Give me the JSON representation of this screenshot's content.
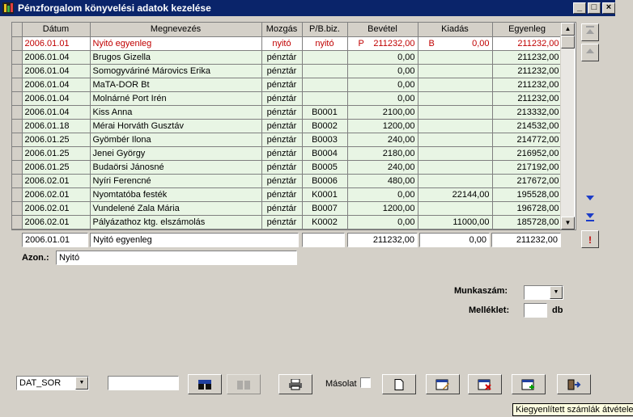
{
  "window": {
    "title": "Pénzforgalom könyvelési adatok kezelése",
    "minimize": "_",
    "restore": "□",
    "close": "×"
  },
  "table": {
    "columns": [
      "Dátum",
      "Megnevezés",
      "Mozgás",
      "P/B.biz.",
      "Bevétel",
      "Kiadás",
      "Egyenleg"
    ],
    "rows": [
      {
        "date": "2006.01.01",
        "name": "Nyitó egyenleg",
        "move": "nyitó",
        "doc": "nyitó",
        "inc_tag": "P",
        "income": "211232,00",
        "exp_tag": "B",
        "expense": "0,00",
        "balance": "211232,00"
      },
      {
        "date": "2006.01.04",
        "name": "Brugos Gizella",
        "move": "pénztár",
        "doc": "",
        "inc_tag": "",
        "income": "0,00",
        "exp_tag": "",
        "expense": "",
        "balance": "211232,00"
      },
      {
        "date": "2006.01.04",
        "name": "Somogyváriné Márovics Erika",
        "move": "pénztár",
        "doc": "",
        "inc_tag": "",
        "income": "0,00",
        "exp_tag": "",
        "expense": "",
        "balance": "211232,00"
      },
      {
        "date": "2006.01.04",
        "name": "MaTA-DOR Bt",
        "move": "pénztár",
        "doc": "",
        "inc_tag": "",
        "income": "0,00",
        "exp_tag": "",
        "expense": "",
        "balance": "211232,00"
      },
      {
        "date": "2006.01.04",
        "name": "Molnárné Port Irén",
        "move": "pénztár",
        "doc": "",
        "inc_tag": "",
        "income": "0,00",
        "exp_tag": "",
        "expense": "",
        "balance": "211232,00"
      },
      {
        "date": "2006.01.04",
        "name": "Kiss Anna",
        "move": "pénztár",
        "doc": "B0001",
        "inc_tag": "",
        "income": "2100,00",
        "exp_tag": "",
        "expense": "",
        "balance": "213332,00"
      },
      {
        "date": "2006.01.18",
        "name": "Mérai Horváth Gusztáv",
        "move": "pénztár",
        "doc": "B0002",
        "inc_tag": "",
        "income": "1200,00",
        "exp_tag": "",
        "expense": "",
        "balance": "214532,00"
      },
      {
        "date": "2006.01.25",
        "name": "Gyömbér Ilona",
        "move": "pénztár",
        "doc": "B0003",
        "inc_tag": "",
        "income": "240,00",
        "exp_tag": "",
        "expense": "",
        "balance": "214772,00"
      },
      {
        "date": "2006.01.25",
        "name": "Jenei György",
        "move": "pénztár",
        "doc": "B0004",
        "inc_tag": "",
        "income": "2180,00",
        "exp_tag": "",
        "expense": "",
        "balance": "216952,00"
      },
      {
        "date": "2006.01.25",
        "name": "Budaörsi Jánosné",
        "move": "pénztár",
        "doc": "B0005",
        "inc_tag": "",
        "income": "240,00",
        "exp_tag": "",
        "expense": "",
        "balance": "217192,00"
      },
      {
        "date": "2006.02.01",
        "name": "Nyíri Ferencné",
        "move": "pénztár",
        "doc": "B0006",
        "inc_tag": "",
        "income": "480,00",
        "exp_tag": "",
        "expense": "",
        "balance": "217672,00"
      },
      {
        "date": "2006.02.01",
        "name": "Nyomtatóba festék",
        "move": "pénztár",
        "doc": "K0001",
        "inc_tag": "",
        "income": "0,00",
        "exp_tag": "",
        "expense": "22144,00",
        "balance": "195528,00"
      },
      {
        "date": "2006.02.01",
        "name": "Vundelené Zala Mária",
        "move": "pénztár",
        "doc": "B0007",
        "inc_tag": "",
        "income": "1200,00",
        "exp_tag": "",
        "expense": "",
        "balance": "196728,00"
      },
      {
        "date": "2006.02.01",
        "name": "Pályázathoz ktg. elszámolás",
        "move": "pénztár",
        "doc": "K0002",
        "inc_tag": "",
        "income": "0,00",
        "exp_tag": "",
        "expense": "11000,00",
        "balance": "185728,00"
      }
    ]
  },
  "edit_row": {
    "date": "2006.01.01",
    "name": "Nyitó egyenleg",
    "doc": "",
    "income": "211232,00",
    "expense": "0,00",
    "balance": "211232,00",
    "alert": "!"
  },
  "azon": {
    "label": "Azon.:",
    "value": "Nyitó"
  },
  "munkaszam": {
    "label": "Munkaszám:",
    "value": ""
  },
  "melleklet": {
    "label": "Melléklet:",
    "value": "",
    "unit": "db"
  },
  "toolbar": {
    "sort_value": "DAT_SOR",
    "search_value": "",
    "copy_label": "Másolat"
  },
  "tooltip": "Kiegyenlített számlák átvétele",
  "colors": {
    "first_row": "#c00000",
    "row_bg": "#e8f5e4",
    "nav_arrow": "#1c3cc8"
  }
}
